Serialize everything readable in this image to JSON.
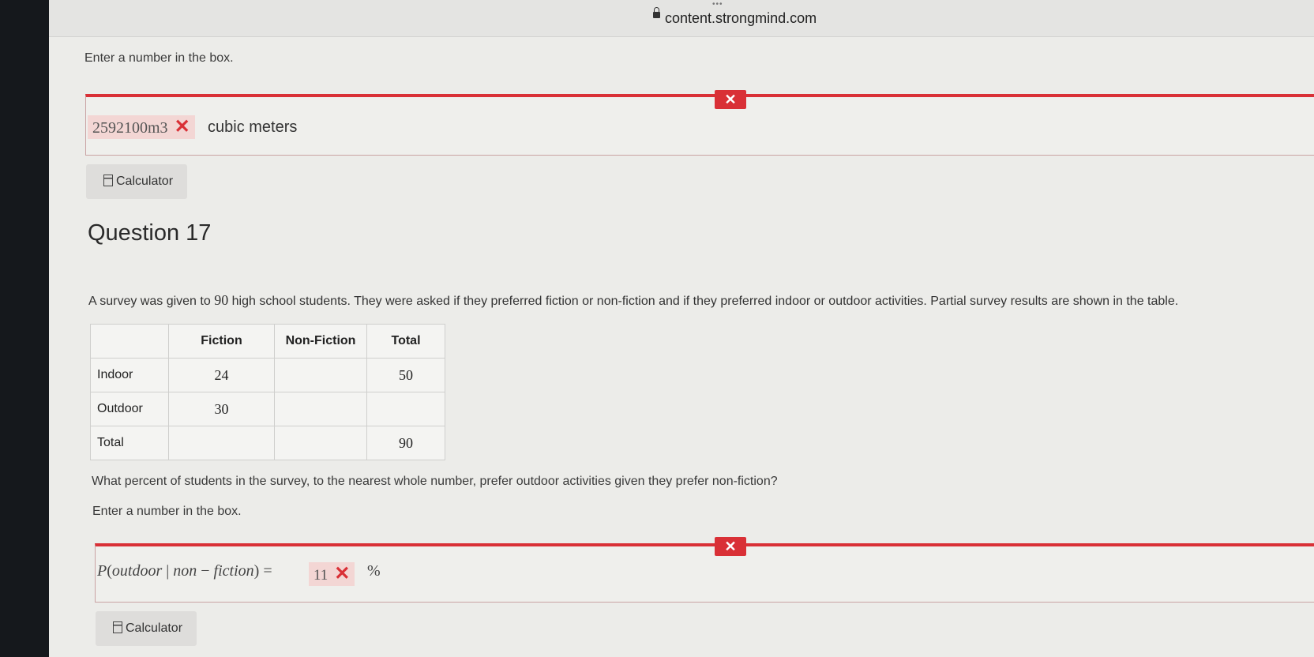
{
  "browser": {
    "url": "content.strongmind.com",
    "dots": "•••"
  },
  "q16": {
    "instruction": "Enter a number in the box.",
    "answer_value": "2592100m3",
    "answer_unit": "cubic meters",
    "calculator_label": "Calculator"
  },
  "q17": {
    "title": "Question 17",
    "prompt_before": "A survey was given to ",
    "prompt_number": "90",
    "prompt_after": " high school students. They were asked if they preferred fiction or non-fiction and if they preferred indoor or outdoor activities. Partial survey results are shown in the table.",
    "table": {
      "headers": [
        "",
        "Fiction",
        "Non-Fiction",
        "Total"
      ],
      "rows": [
        [
          "Indoor",
          "24",
          "",
          "50"
        ],
        [
          "Outdoor",
          "30",
          "",
          ""
        ],
        [
          "Total",
          "",
          "",
          "90"
        ]
      ]
    },
    "question": "What percent of students in the survey, to the nearest whole number, prefer outdoor activities given they prefer non-fiction?",
    "instruction": "Enter a number in the box.",
    "formula_p": "P",
    "formula_open": "(",
    "formula_outdoor": "outdoor",
    "formula_bar": "|",
    "formula_non": "non",
    "formula_minus": "−",
    "formula_fiction": "fiction",
    "formula_close": ")",
    "formula_equals": "=",
    "answer_value": "11",
    "percent": "%",
    "calculator_label": "Calculator"
  },
  "status": {
    "wrong_mark": "✕"
  },
  "colors": {
    "error": "#d93036",
    "error_bg": "#f3d6d4"
  }
}
